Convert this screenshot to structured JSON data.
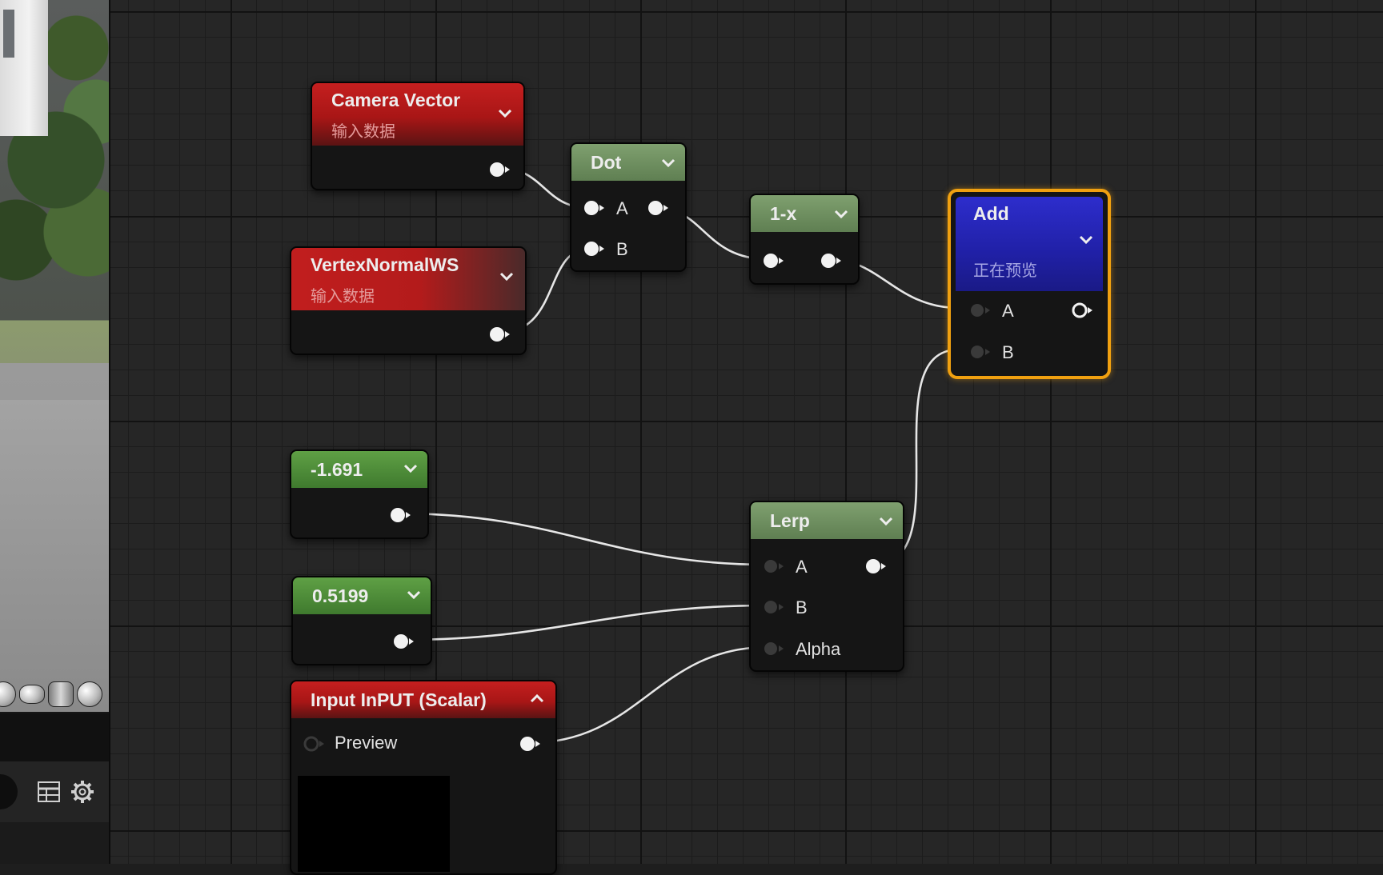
{
  "left_panel": {
    "preview_shapes": [
      "sphere-icon",
      "plane-icon",
      "cylinder-icon",
      "cube-icon"
    ],
    "toolbar_icons": [
      "grid-table-icon",
      "gear-icon"
    ]
  },
  "nodes": {
    "camera_vector": {
      "title": "Camera Vector",
      "subtitle": "输入数据"
    },
    "vertex_normal": {
      "title": "VertexNormalWS",
      "subtitle": "输入数据"
    },
    "dot": {
      "title": "Dot",
      "pin_a": "A",
      "pin_b": "B"
    },
    "one_minus": {
      "title": "1-x"
    },
    "add": {
      "title": "Add",
      "subtitle": "正在预览",
      "pin_a": "A",
      "pin_b": "B"
    },
    "const_a": {
      "title": "-1.691"
    },
    "const_b": {
      "title": "0.5199"
    },
    "lerp": {
      "title": "Lerp",
      "pin_a": "A",
      "pin_b": "B",
      "pin_alpha": "Alpha"
    },
    "input_scalar": {
      "title": "Input InPUT (Scalar)",
      "preview_label": "Preview"
    }
  },
  "colors": {
    "input_header": "#c51f1f",
    "math_header": "#5f7f52",
    "constant_header": "#4f8f3a",
    "preview_header": "#2424b8",
    "selection_outline": "#f0a010",
    "wire": "#e6e6e6"
  }
}
